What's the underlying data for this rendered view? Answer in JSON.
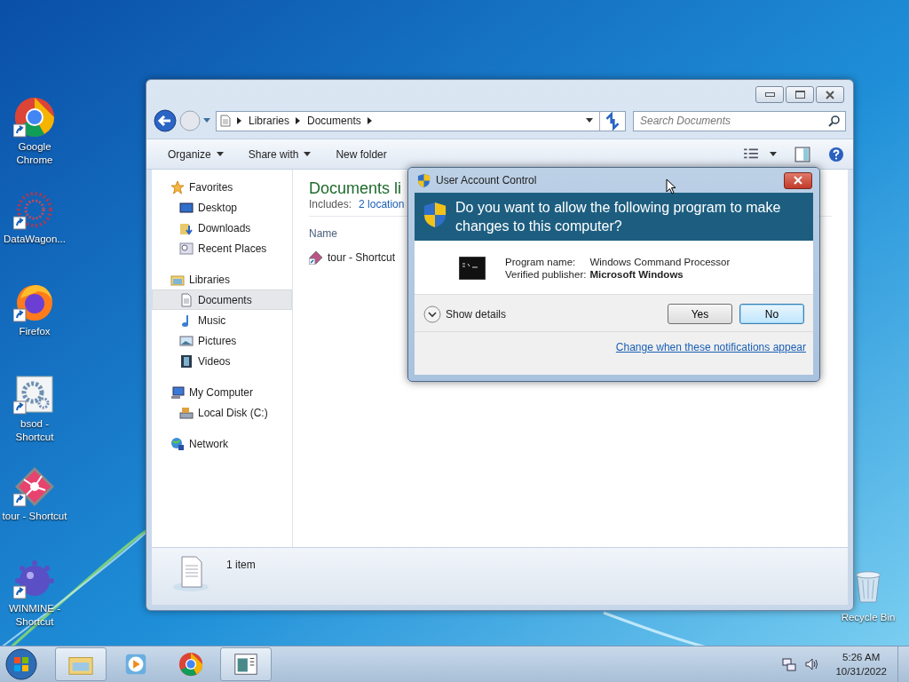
{
  "desktop_icons": [
    {
      "label": "Google Chrome",
      "kind": "chrome"
    },
    {
      "label": "DataWagon...",
      "kind": "datawagon"
    },
    {
      "label": "Firefox",
      "kind": "firefox"
    },
    {
      "label": "bsod - Shortcut",
      "kind": "settings"
    },
    {
      "label": "tour - Shortcut",
      "kind": "tour"
    },
    {
      "label": "WINMINE - Shortcut",
      "kind": "mine"
    }
  ],
  "recycle_bin": {
    "label": "Recycle Bin"
  },
  "explorer": {
    "breadcrumb": [
      "Libraries",
      "Documents"
    ],
    "search": {
      "placeholder": "Search Documents"
    },
    "toolbar": [
      {
        "label": "Organize",
        "dropdown": true
      },
      {
        "label": "Share with",
        "dropdown": true
      },
      {
        "label": "New folder",
        "dropdown": false
      }
    ],
    "nav": [
      {
        "label": "Favorites",
        "kind": "star",
        "selected": false,
        "children": [
          {
            "label": "Desktop",
            "kind": "desktop",
            "selected": false
          },
          {
            "label": "Downloads",
            "kind": "downloads",
            "selected": false
          },
          {
            "label": "Recent Places",
            "kind": "recent",
            "selected": false
          }
        ]
      },
      {
        "label": "Libraries",
        "kind": "library",
        "selected": false,
        "children": [
          {
            "label": "Documents",
            "kind": "document",
            "selected": true
          },
          {
            "label": "Music",
            "kind": "music",
            "selected": false
          },
          {
            "label": "Pictures",
            "kind": "pictures",
            "selected": false
          },
          {
            "label": "Videos",
            "kind": "videos",
            "selected": false
          }
        ]
      },
      {
        "label": "My Computer",
        "kind": "computer",
        "selected": false,
        "children": [
          {
            "label": "Local Disk (C:)",
            "kind": "disk",
            "selected": false
          }
        ]
      },
      {
        "label": "Network",
        "kind": "network",
        "selected": false
      }
    ],
    "library_title": "Documents li",
    "includes_label": "Includes:",
    "includes_link": "2 location",
    "column": "Name",
    "files": [
      {
        "name": "tour - Shortcut"
      }
    ],
    "status": "1 item"
  },
  "uac": {
    "title": "User Account Control",
    "question": "Do you want to allow the following program to make changes to this computer?",
    "fields": [
      {
        "label": "Program name:",
        "value": "Windows Command Processor",
        "emphasis": false
      },
      {
        "label": "Verified publisher:",
        "value": "Microsoft Windows",
        "emphasis": true
      }
    ],
    "details": "Show details",
    "buttons": [
      {
        "label": "Yes",
        "focused": false
      },
      {
        "label": "No",
        "focused": true
      }
    ],
    "link": "Change when these notifications appear"
  },
  "taskbar": {
    "items": [
      {
        "kind": "explorer",
        "active": true
      },
      {
        "kind": "media",
        "active": false
      },
      {
        "kind": "chrome",
        "active": false
      },
      {
        "kind": "app",
        "active": true
      }
    ],
    "time": "5:26 AM",
    "date": "10/31/2022"
  }
}
